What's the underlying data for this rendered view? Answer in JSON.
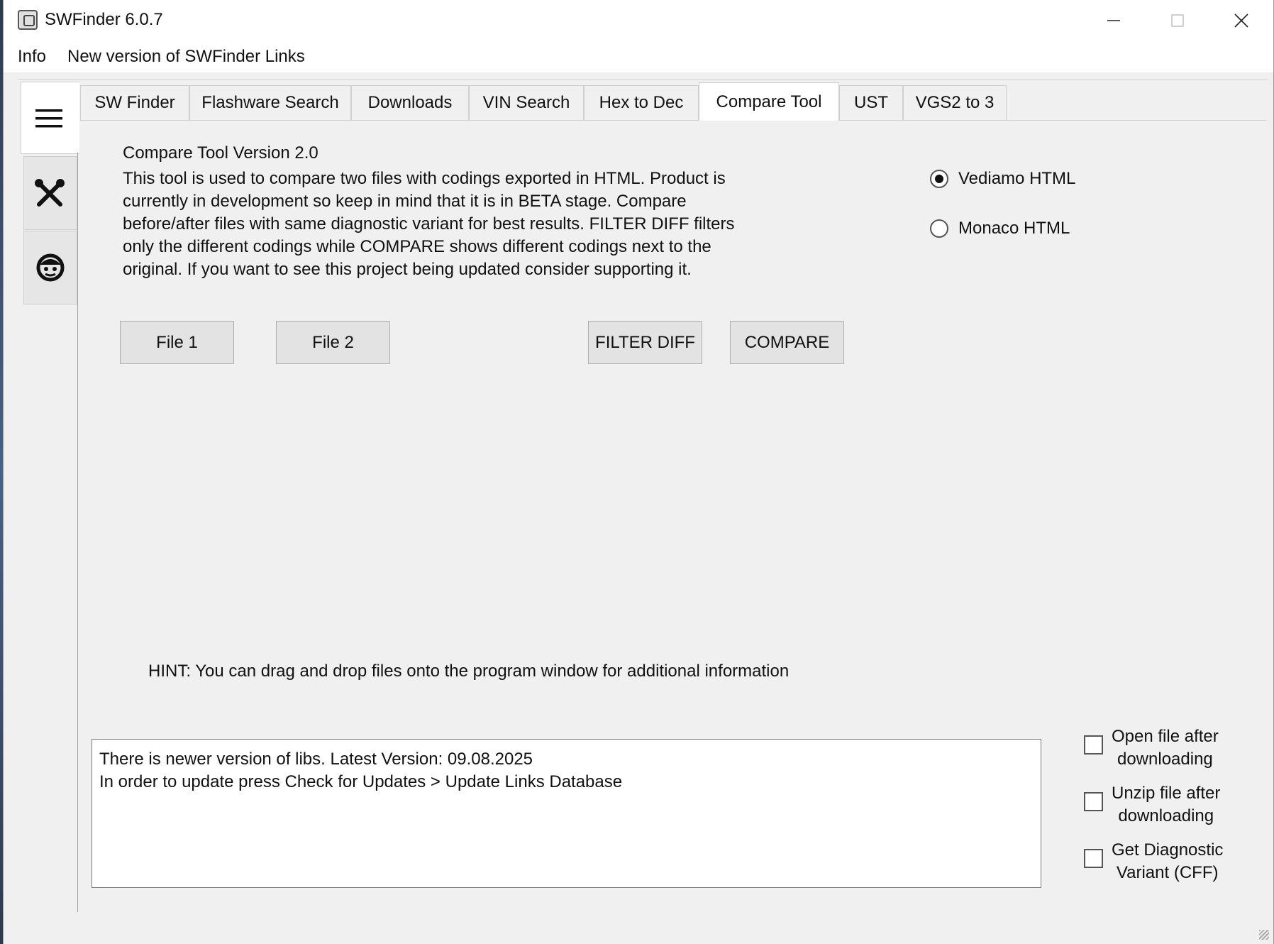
{
  "window": {
    "title": "SWFinder 6.0.7"
  },
  "menu": {
    "info": "Info",
    "links": "New version of SWFinder Links"
  },
  "tabs": [
    {
      "label": "SW Finder"
    },
    {
      "label": "Flashware Search"
    },
    {
      "label": "Downloads"
    },
    {
      "label": "VIN Search"
    },
    {
      "label": "Hex to Dec"
    },
    {
      "label": "Compare Tool"
    },
    {
      "label": "UST"
    },
    {
      "label": "VGS2 to 3"
    }
  ],
  "active_tab": "Compare Tool",
  "sidebar": {
    "icons": [
      "hamburger-menu-icon",
      "tools-icon",
      "face-icon"
    ]
  },
  "compare": {
    "version_title": "Compare Tool Version 2.0",
    "description": "This tool is used to compare two files with codings exported in HTML. Product is currently in development so keep in mind that it is in BETA stage. Compare before/after files with same diagnostic variant for best results. FILTER DIFF filters only the different codings while COMPARE shows different codings next to the original. If you want to see this project being updated consider supporting it.",
    "format_options": [
      {
        "label": "Vediamo HTML",
        "selected": true
      },
      {
        "label": "Monaco HTML",
        "selected": false
      }
    ],
    "buttons": {
      "file1": "File 1",
      "file2": "File 2",
      "filter_diff": "FILTER DIFF",
      "compare": "COMPARE"
    },
    "hint": "HINT: You can drag and drop files onto the program window for additional information"
  },
  "log": {
    "lines": [
      "There is newer version of libs. Latest Version: 09.08.2025",
      "In order to update press Check for Updates > Update Links Database"
    ]
  },
  "options": [
    {
      "line1": "Open file after",
      "line2": "downloading",
      "checked": false
    },
    {
      "line1": "Unzip file after",
      "line2": "downloading",
      "checked": false
    },
    {
      "line1": "Get Diagnostic",
      "line2": "Variant (CFF)",
      "checked": false
    }
  ]
}
